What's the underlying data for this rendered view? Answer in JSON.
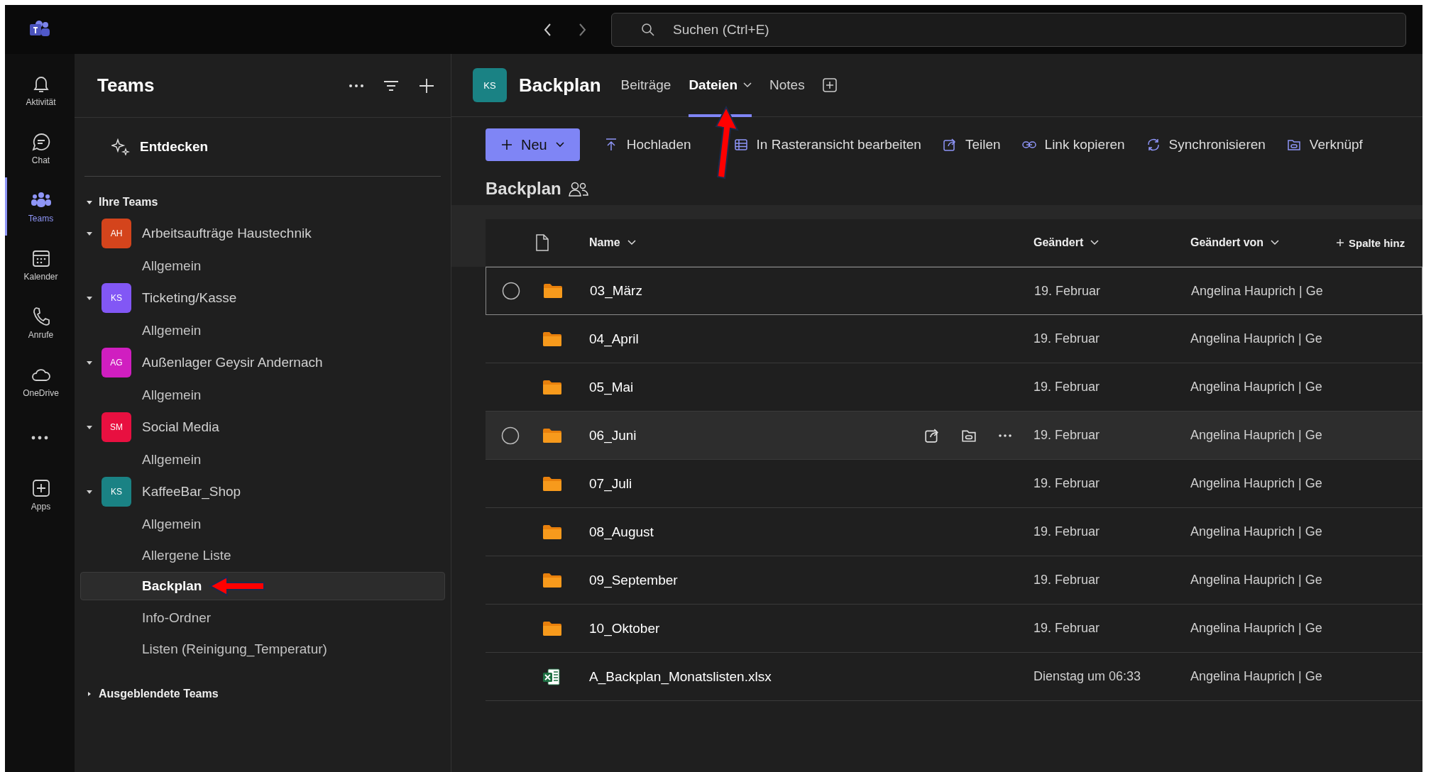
{
  "search": {
    "placeholder": "Suchen (Ctrl+E)"
  },
  "rail": [
    {
      "label": "Aktivität",
      "selected": false
    },
    {
      "label": "Chat",
      "selected": false
    },
    {
      "label": "Teams",
      "selected": true
    },
    {
      "label": "Kalender",
      "selected": false
    },
    {
      "label": "Anrufe",
      "selected": false
    },
    {
      "label": "OneDrive",
      "selected": false
    },
    {
      "label": "Apps",
      "selected": false
    }
  ],
  "sidebar": {
    "title": "Teams",
    "discover": "Entdecken",
    "section": {
      "label": "Ihre Teams",
      "expanded": true
    },
    "teams": [
      {
        "initials": "AH",
        "name": "Arbeitsaufträge Haustechnik",
        "color": "#d4441c",
        "expanded": true,
        "channels": [
          {
            "name": "Allgemein",
            "selected": false
          }
        ]
      },
      {
        "initials": "KS",
        "name": "Ticketing/Kasse",
        "color": "#8257f5",
        "expanded": true,
        "channels": [
          {
            "name": "Allgemein",
            "selected": false
          }
        ]
      },
      {
        "initials": "AG",
        "name": "Außenlager Geysir Andernach",
        "color": "#d01ec0",
        "expanded": true,
        "channels": [
          {
            "name": "Allgemein",
            "selected": false
          }
        ]
      },
      {
        "initials": "SM",
        "name": "Social Media",
        "color": "#e81040",
        "expanded": true,
        "channels": [
          {
            "name": "Allgemein",
            "selected": false
          }
        ]
      },
      {
        "initials": "KS",
        "name": "KaffeeBar_Shop",
        "color": "#1a8284",
        "expanded": true,
        "channels": [
          {
            "name": "Allgemein",
            "selected": false
          },
          {
            "name": "Allergene Liste",
            "selected": false
          },
          {
            "name": "Backplan",
            "selected": true
          },
          {
            "name": "Info-Ordner",
            "selected": false
          },
          {
            "name": "Listen (Reinigung_Temperatur)",
            "selected": false
          }
        ]
      }
    ],
    "hidden": {
      "label": "Ausgeblendete Teams",
      "expanded": false
    }
  },
  "channel": {
    "initials": "KS",
    "color": "#1a8284",
    "title": "Backplan",
    "tabs": [
      {
        "label": "Beiträge",
        "selected": false,
        "dropdown": false
      },
      {
        "label": "Dateien",
        "selected": true,
        "dropdown": true
      },
      {
        "label": "Notes",
        "selected": false,
        "dropdown": false
      }
    ]
  },
  "toolbar": {
    "new": "Neu",
    "actions": [
      "Hochladen",
      "In Rasteransicht bearbeiten",
      "Teilen",
      "Link kopieren",
      "Synchronisieren",
      "Verknüpf"
    ]
  },
  "library": {
    "title": "Backplan"
  },
  "table": {
    "columns": [
      "Name",
      "Geändert",
      "Geändert von",
      "Spalte hinz"
    ],
    "rows": [
      {
        "kind": "folder",
        "name": "03_März",
        "modified": "19. Februar",
        "modified_by": "Angelina Hauprich | Ge",
        "focused": true,
        "hovered": false
      },
      {
        "kind": "folder",
        "name": "04_April",
        "modified": "19. Februar",
        "modified_by": "Angelina Hauprich | Ge",
        "focused": false,
        "hovered": false
      },
      {
        "kind": "folder",
        "name": "05_Mai",
        "modified": "19. Februar",
        "modified_by": "Angelina Hauprich | Ge",
        "focused": false,
        "hovered": false
      },
      {
        "kind": "folder",
        "name": "06_Juni",
        "modified": "19. Februar",
        "modified_by": "Angelina Hauprich | Ge",
        "focused": false,
        "hovered": true
      },
      {
        "kind": "folder",
        "name": "07_Juli",
        "modified": "19. Februar",
        "modified_by": "Angelina Hauprich | Ge",
        "focused": false,
        "hovered": false
      },
      {
        "kind": "folder",
        "name": "08_August",
        "modified": "19. Februar",
        "modified_by": "Angelina Hauprich | Ge",
        "focused": false,
        "hovered": false
      },
      {
        "kind": "folder",
        "name": "09_September",
        "modified": "19. Februar",
        "modified_by": "Angelina Hauprich | Ge",
        "focused": false,
        "hovered": false
      },
      {
        "kind": "folder",
        "name": "10_Oktober",
        "modified": "19. Februar",
        "modified_by": "Angelina Hauprich | Ge",
        "focused": false,
        "hovered": false
      },
      {
        "kind": "excel",
        "name": "A_Backplan_Monatslisten.xlsx",
        "modified": "Dienstag um 06:33",
        "modified_by": "Angelina Hauprich | Ge",
        "focused": false,
        "hovered": false
      }
    ]
  }
}
